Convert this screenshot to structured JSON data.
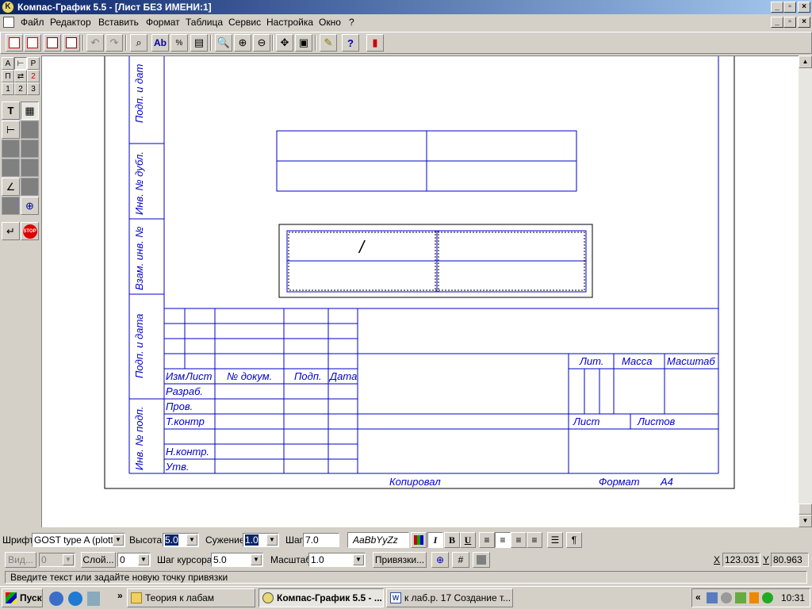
{
  "window": {
    "title": "Компас-График 5.5 - [Лист БЕЗ ИМЕНИ:1]"
  },
  "menu": [
    "Файл",
    "Редактор",
    "Вставить",
    "Формат",
    "Таблица",
    "Сервис",
    "Настройка",
    "Окно",
    "?"
  ],
  "left_panel": {
    "tabs_row1": [
      "А",
      "Р"
    ],
    "tabs_row2": [
      "П",
      "2"
    ],
    "numbers": [
      "1",
      "2",
      "3"
    ]
  },
  "drawing": {
    "side_labels": [
      "Подп. и дат",
      "Инв. № дубл.",
      "Взам. инв. №",
      "Подп. и дата",
      "Инв. № подп."
    ],
    "slash": "/",
    "stamp_headers": [
      "Изм",
      "Лист",
      "№ докум.",
      "Подп.",
      "Дата"
    ],
    "stamp_rows": [
      "Разраб.",
      "Пров.",
      "Т.контр",
      "Н.контр.",
      "Утв."
    ],
    "stamp_right": [
      "Лит.",
      "Масса",
      "Масштаб"
    ],
    "sheet_labels": [
      "Лист",
      "Листов"
    ],
    "copied": "Копировал",
    "format": "Формат",
    "format_value": "A4"
  },
  "propbar": {
    "font_label": "Шрифт",
    "font_value": "GOST type A (plotte",
    "height_label": "Высота",
    "height_value": "5.0",
    "narrow_label": "Сужение",
    "narrow_value": "1.0",
    "step_label": "Шаг",
    "step_value": "7.0",
    "preview": "AaBbYyZz",
    "bold": "B",
    "italic": "I",
    "underline": "U",
    "para": "¶"
  },
  "propbar2": {
    "view_label": "Вид...",
    "view_value": "0",
    "layer_label": "Слой...",
    "layer_value": "0",
    "cursor_step_label": "Шаг курсора",
    "cursor_step_value": "5.0",
    "scale_label": "Масштаб",
    "scale_value": "1.0",
    "snaps_label": "Привязки...",
    "x_label": "X",
    "x_value": "123.031",
    "y_label": "Y",
    "y_value": "80.963"
  },
  "status_text": "Введите текст или задайте новую точку привязки",
  "taskbar": {
    "start": "Пуск",
    "tasks": [
      "Теория к лабам",
      "Компас-График 5.5 - ...",
      "к лаб.р. 17 Создание т..."
    ],
    "clock": "10:31"
  },
  "colors": {
    "drawing_line": "#0000c8",
    "title_start": "#0a246a",
    "title_end": "#a6caf0"
  }
}
